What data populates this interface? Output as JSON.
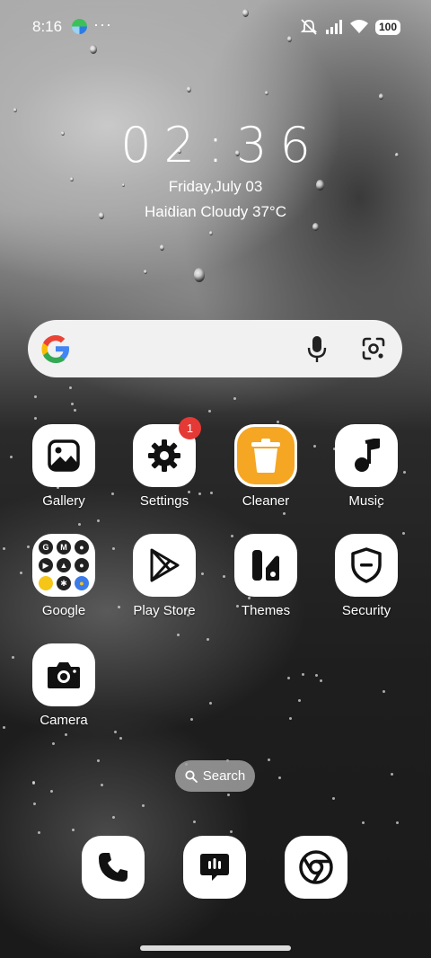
{
  "status_bar": {
    "time": "8:16",
    "more_indicator": "···",
    "battery": "100",
    "icons": [
      "app-notification-icon",
      "mute-icon",
      "signal-icon",
      "wifi-icon",
      "battery-icon"
    ]
  },
  "clock_widget": {
    "time": "02:36",
    "date": "Friday,July 03",
    "weather": "Haidian Cloudy 37°C"
  },
  "search_bar": {
    "icons": [
      "google-logo-icon",
      "microphone-icon",
      "google-lens-icon"
    ]
  },
  "apps": [
    {
      "label": "Gallery",
      "icon": "gallery-icon"
    },
    {
      "label": "Settings",
      "icon": "gear-icon",
      "badge": "1"
    },
    {
      "label": "Cleaner",
      "icon": "trash-icon"
    },
    {
      "label": "Music",
      "icon": "music-note-icon"
    },
    {
      "label": "Google",
      "icon": "folder-icon"
    },
    {
      "label": "Play Store",
      "icon": "play-store-icon"
    },
    {
      "label": "Themes",
      "icon": "themes-icon"
    },
    {
      "label": "Security",
      "icon": "shield-icon"
    },
    {
      "label": "Camera",
      "icon": "camera-icon"
    }
  ],
  "google_folder": {
    "items": [
      "G",
      "M",
      "●",
      "▶",
      "▲",
      "●",
      "●",
      "✱",
      "●"
    ]
  },
  "app_search_pill": {
    "label": "Search",
    "icon": "search-icon"
  },
  "dock": [
    {
      "name": "Phone",
      "icon": "phone-icon"
    },
    {
      "name": "Messages",
      "icon": "message-icon"
    },
    {
      "name": "Chrome",
      "icon": "chrome-icon"
    }
  ],
  "colors": {
    "accent_cleaner": "#f5a623",
    "badge": "#e53935",
    "icon_bg": "#ffffff"
  }
}
